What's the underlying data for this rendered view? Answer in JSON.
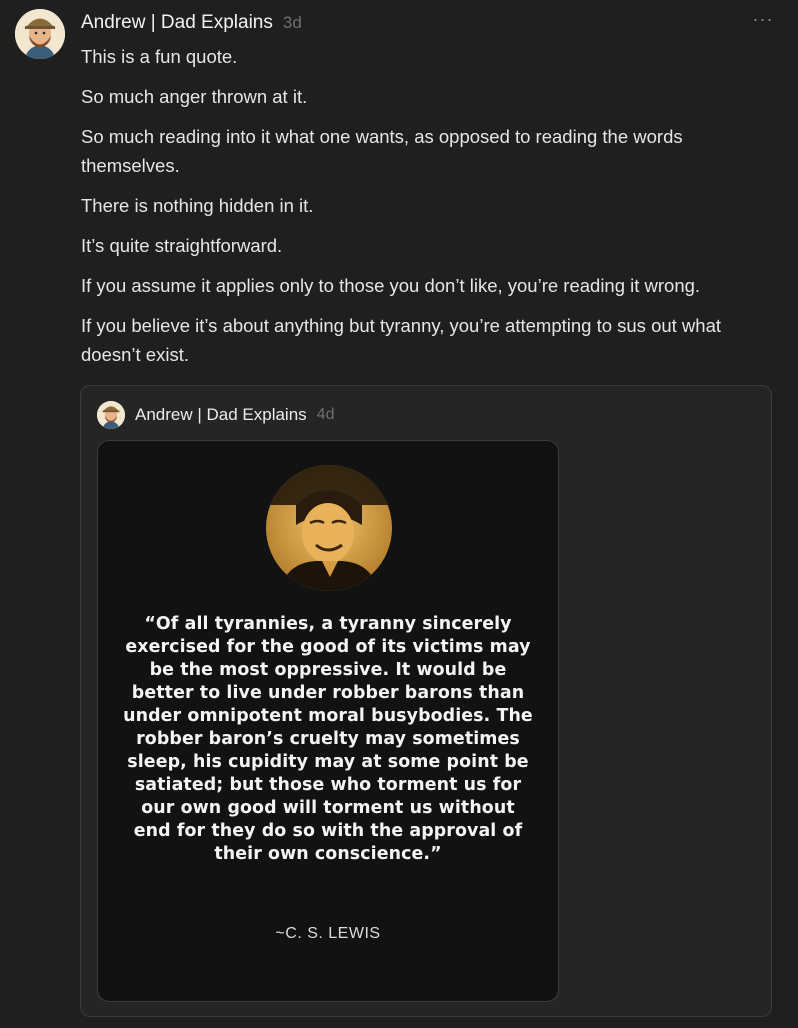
{
  "post": {
    "author": "Andrew | Dad Explains",
    "time": "3d",
    "menu_label": "···",
    "paragraphs": [
      "This is a fun quote.",
      "So much anger thrown at it.",
      "So much reading into it what one wants, as opposed to reading the words themselves.",
      "There is nothing hidden in it.",
      "It’s quite straightforward.",
      "If you assume it applies only to those you don’t like, you’re reading it wrong.",
      "If you believe it’s about anything but tyranny, you’re attempting to sus out what doesn’t exist."
    ]
  },
  "quoted": {
    "author": "Andrew | Dad Explains",
    "time": "4d",
    "image": {
      "quote": "“Of all tyrannies, a tyranny sincerely exercised for the good of its victims may be the most oppressive. It would be better to live under robber barons than under omnipotent moral busybodies. The robber baron’s cruelty may sometimes sleep, his cupidity may at some point be satiated; but those who torment us for our own good will torment us without end for they do so with the approval of their own conscience.”",
      "attribution": "~C. S. LEWIS",
      "portrait_tint": "#e0a94a"
    }
  },
  "icons": {
    "avatar": "avatar-icon",
    "more": "more-options-icon"
  },
  "colors": {
    "background": "#1f1f1f",
    "card": "#252525",
    "muted": "#6f6f6f",
    "text": "#e6e6e6"
  }
}
